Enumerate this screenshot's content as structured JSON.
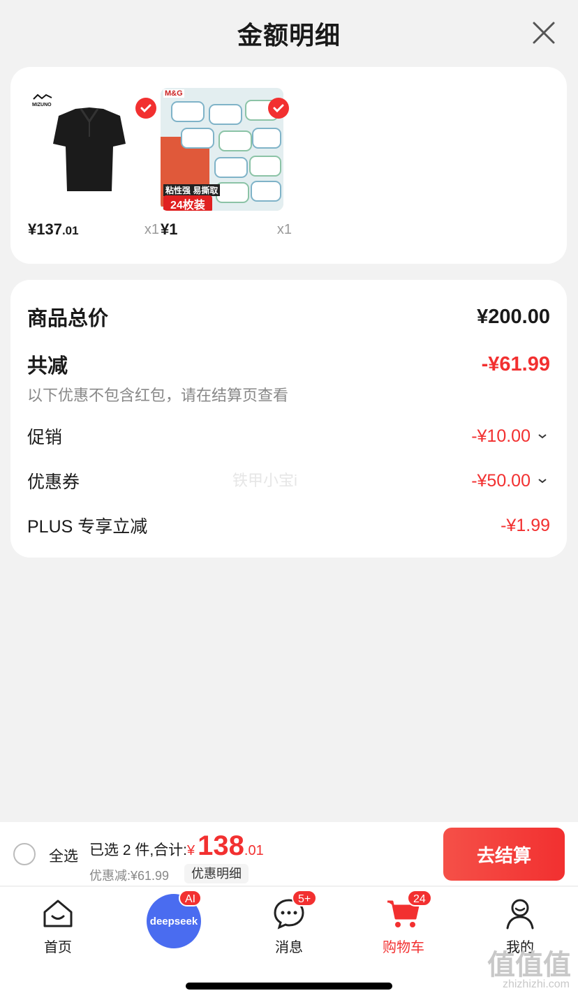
{
  "header": {
    "title": "金额明细"
  },
  "products": [
    {
      "price_int": "¥137",
      "price_dec": ".01",
      "qty": "x1",
      "brand": "MIZUNO"
    },
    {
      "price_int": "¥1",
      "price_dec": "",
      "qty": "x1",
      "brand": "M&G",
      "promo_line1": "粘性强 易撕取",
      "promo_line2": "24枚装"
    }
  ],
  "summary": {
    "total_label": "商品总价",
    "total_value": "¥200.00",
    "reduction_label": "共减",
    "reduction_value": "-¥61.99",
    "note": "以下优惠不包含红包，请在结算页查看",
    "items": [
      {
        "label": "促销",
        "value": "-¥10.00"
      },
      {
        "label": "优惠券",
        "value": "-¥50.00"
      },
      {
        "label": "PLUS 专享立减",
        "value": "-¥1.99"
      }
    ],
    "watermark": "铁甲小宝i"
  },
  "checkout": {
    "select_all": "全选",
    "selected_text": "已选 2 件,合计:",
    "currency": "¥",
    "total_int": "138",
    "total_dec": ".01",
    "discount_text": "优惠减:¥61.99",
    "detail_chip": "优惠明细",
    "button": "去结算"
  },
  "tabs": [
    {
      "label": "首页",
      "icon": "home-icon"
    },
    {
      "label": "deepseek",
      "badge": "AI",
      "icon": "deepseek-icon"
    },
    {
      "label": "消息",
      "badge": "5+",
      "icon": "message-icon"
    },
    {
      "label": "购物车",
      "badge": "24",
      "icon": "cart-icon"
    },
    {
      "label": "我的",
      "icon": "profile-icon"
    }
  ],
  "site": {
    "mark": "值值值",
    "url": "zhizhizhi.com"
  },
  "colors": {
    "accent": "#f23030",
    "deepseek": "#4a6cf0",
    "background": "#f2f2f2"
  }
}
